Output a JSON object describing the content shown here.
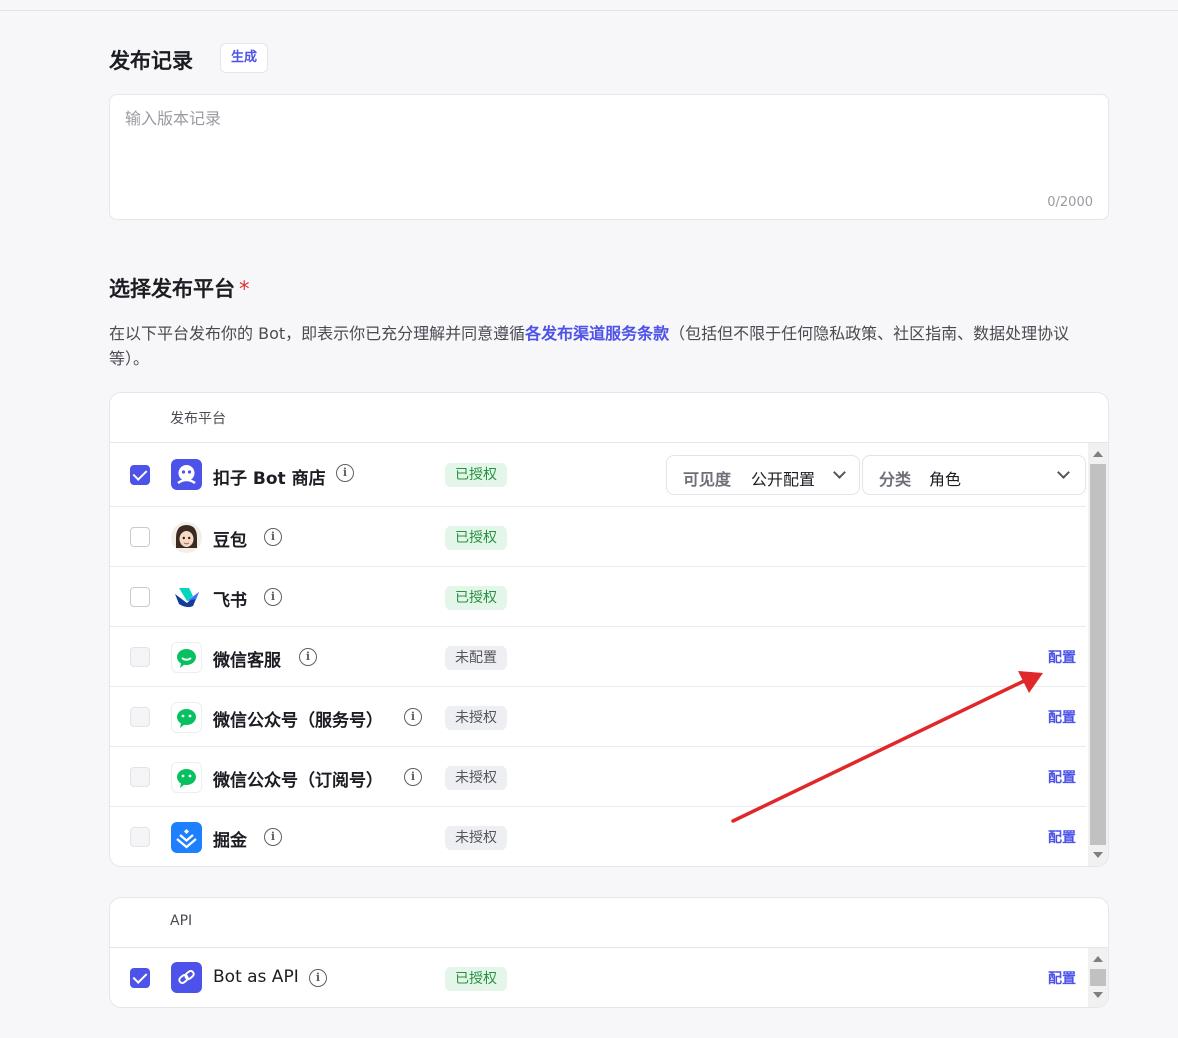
{
  "release_notes": {
    "title": "发布记录",
    "generate_label": "生成",
    "placeholder": "输入版本记录",
    "counter": "0/2000"
  },
  "platform_section": {
    "title": "选择发布平台",
    "required_mark": "*",
    "desc_before": "在以下平台发布你的 Bot，即表示你已充分理解并同意遵循",
    "desc_link": "各发布渠道服务条款",
    "desc_after": "（包括但不限于任何隐私政策、社区指南、数据处理协议等）。",
    "column_header": "发布平台",
    "visibility_label": "可见度",
    "visibility_value": "公开配置",
    "category_label": "分类",
    "category_value": "角色",
    "platforms": [
      {
        "name": "扣子 Bot 商店",
        "status": "已授权",
        "checked": true,
        "icon": "coze-store-icon"
      },
      {
        "name": "豆包",
        "status": "已授权",
        "checked": false,
        "icon": "doubao-avatar-icon"
      },
      {
        "name": "飞书",
        "status": "已授权",
        "checked": false,
        "icon": "feishu-icon"
      },
      {
        "name": "微信客服",
        "status": "未配置",
        "checked": false,
        "config": "配置",
        "icon": "wechat-icon"
      },
      {
        "name": "微信公众号（服务号）",
        "status": "未授权",
        "checked": false,
        "config": "配置",
        "icon": "wechat-icon"
      },
      {
        "name": "微信公众号（订阅号）",
        "status": "未授权",
        "checked": false,
        "config": "配置",
        "icon": "wechat-icon"
      },
      {
        "name": "掘金",
        "status": "未授权",
        "checked": false,
        "config": "配置",
        "icon": "juejin-icon"
      }
    ]
  },
  "api_section": {
    "column_header": "API",
    "item": {
      "name": "Bot as API",
      "status": "已授权",
      "checked": true,
      "config": "配置",
      "icon": "link-icon"
    }
  },
  "info_glyph": "i",
  "colors": {
    "accent": "#4d53e8",
    "authorized_bg": "#e4f5ea",
    "authorized_text": "#27923f",
    "annotation_arrow": "#e0282a"
  }
}
